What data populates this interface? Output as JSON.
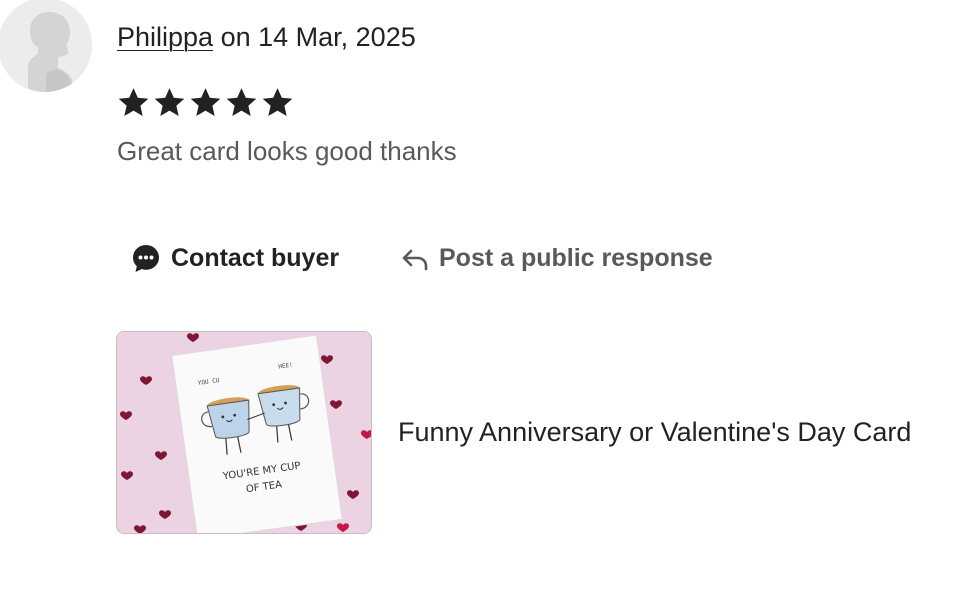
{
  "review": {
    "reviewer_name": "Philippa",
    "date_text": " on 14 Mar, 2025",
    "rating": 5,
    "rating_max": 5,
    "text": "Great card looks good thanks"
  },
  "actions": {
    "contact_label": "Contact buyer",
    "respond_label": "Post a public response"
  },
  "listing": {
    "title": "Funny Anniversary or Valentine's Day Card",
    "card_text_line1": "YOU'RE MY CUP",
    "card_text_line2": "OF TEA",
    "card_small_left": "YOU CU",
    "card_small_right": "HEE!"
  },
  "icons": {
    "avatar": "avatar-silhouette",
    "star": "star-icon",
    "contact": "chat-bubble-icon",
    "respond": "reply-arrow-icon"
  },
  "colors": {
    "text_primary": "#222222",
    "text_secondary": "#595959",
    "card_background": "#ecd3e3",
    "heart": "#8a1b3a"
  }
}
